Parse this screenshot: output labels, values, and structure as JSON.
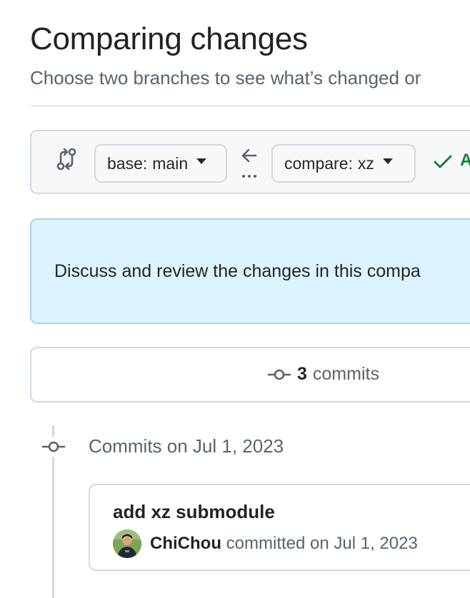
{
  "header": {
    "title": "Comparing changes",
    "subtitle": "Choose two branches to see what’s changed or"
  },
  "range": {
    "base_label": "base:",
    "base_branch": "main",
    "compare_label": "compare:",
    "compare_branch": "xz",
    "status_text": "A"
  },
  "info": {
    "text": "Discuss and review the changes in this compa"
  },
  "summary": {
    "commit_count": "3",
    "commit_word": "commits"
  },
  "timeline": {
    "date_heading": "Commits on Jul 1, 2023",
    "commits": [
      {
        "message": "add xz submodule",
        "author": "ChiChou",
        "meta": "committed on Jul 1, 2023"
      }
    ]
  },
  "colors": {
    "success": "#1a7f37",
    "info_bg": "#ddf4ff",
    "info_border": "#a7d2f5",
    "border": "#d1d9e0",
    "muted_text": "#59636e"
  },
  "icons": {
    "range": "git-compare-icon",
    "direction": "arrow-left-icon",
    "status": "check-icon",
    "commit": "git-commit-icon"
  }
}
